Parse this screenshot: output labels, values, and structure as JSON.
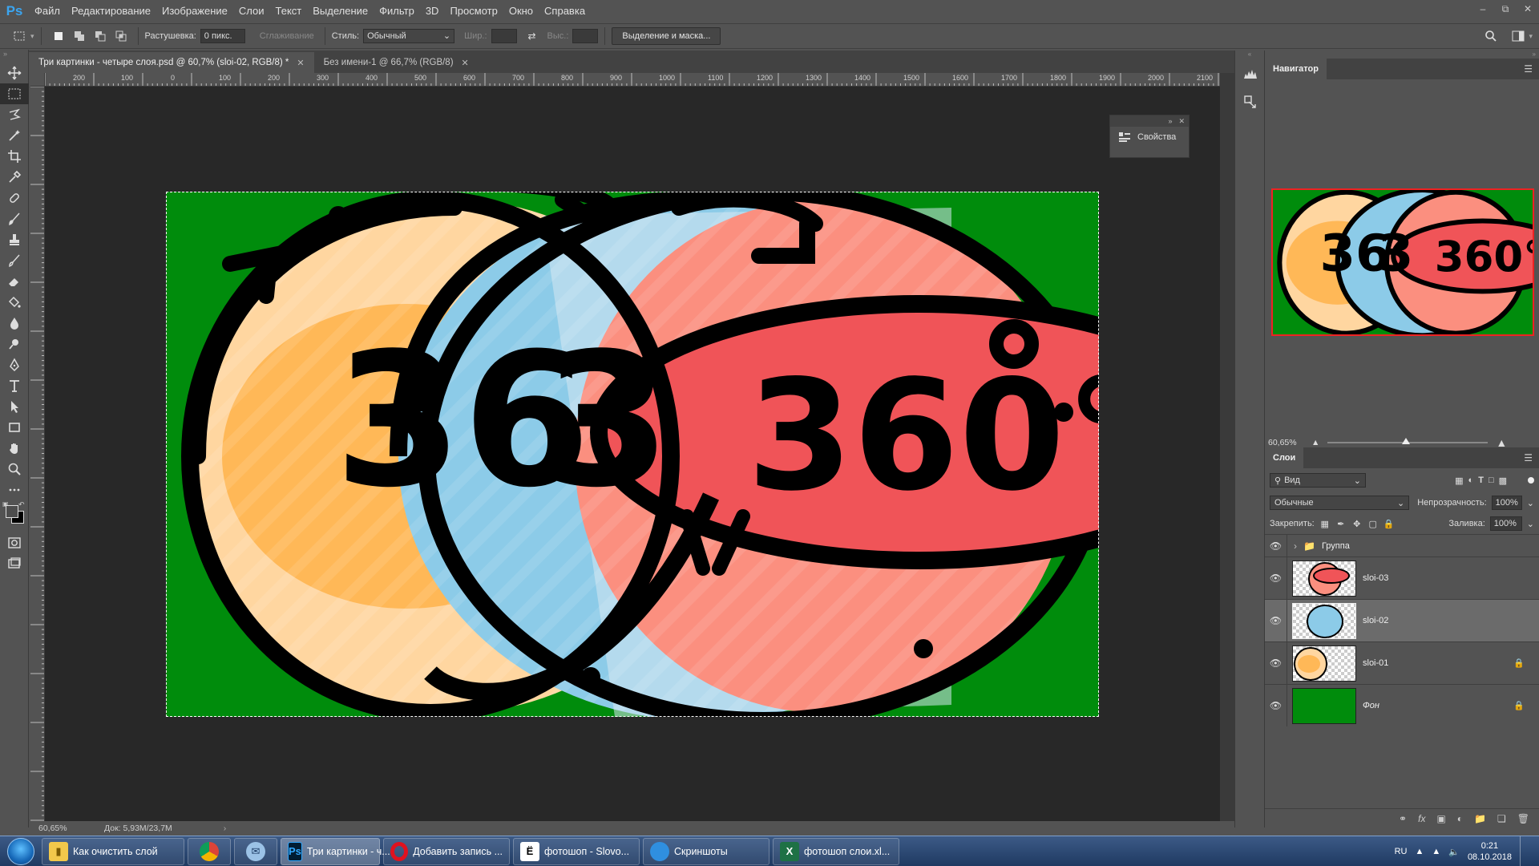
{
  "app": {
    "logo": "Ps",
    "menu": [
      "Файл",
      "Редактирование",
      "Изображение",
      "Слои",
      "Текст",
      "Выделение",
      "Фильтр",
      "3D",
      "Просмотр",
      "Окно",
      "Справка"
    ]
  },
  "options": {
    "feather_label": "Растушевка:",
    "feather_value": "0 пикс.",
    "antialias_label": "Сглаживание",
    "style_label": "Стиль:",
    "style_value": "Обычный",
    "width_label": "Шир.:",
    "height_label": "Выс.:",
    "select_mask_button": "Выделение и маска..."
  },
  "tabs": [
    {
      "label": "Три картинки - четыре слоя.psd @ 60,7% (sloi-02, RGB/8) *",
      "active": true
    },
    {
      "label": "Без имени-1 @ 66,7% (RGB/8)",
      "active": false
    }
  ],
  "ruler": {
    "h_ticks": [
      "200",
      "100",
      "0",
      "100",
      "200",
      "300",
      "400",
      "500",
      "600",
      "700",
      "800",
      "900",
      "1000",
      "1100",
      "1200",
      "1300",
      "1400",
      "1500",
      "1600",
      "1700",
      "1800",
      "1900",
      "2000",
      "2100"
    ]
  },
  "properties_float": {
    "label": "Свойства"
  },
  "status": {
    "zoom": "60,65%",
    "doc": "Док: 5,93M/23,7M"
  },
  "navigator": {
    "title": "Навигатор",
    "zoom": "60,65%"
  },
  "layers": {
    "title": "Слои",
    "filter_value": "Вид",
    "blend_mode": "Обычные",
    "opacity_label": "Непрозрачность:",
    "opacity_value": "100%",
    "lock_label": "Закрепить:",
    "fill_label": "Заливка:",
    "fill_value": "100%",
    "items": [
      {
        "name": "Группа",
        "type": "group"
      },
      {
        "name": "sloi-03",
        "type": "image"
      },
      {
        "name": "sloi-02",
        "type": "image",
        "selected": true
      },
      {
        "name": "sloi-01",
        "type": "image",
        "locked": true
      },
      {
        "name": "Фон",
        "type": "background",
        "locked": true
      }
    ]
  },
  "artwork": {
    "bg_color": "#008c0c",
    "labels": {
      "left": "36",
      "middle": "3",
      "right": "360°"
    }
  },
  "taskbar": {
    "items": [
      {
        "label": "Как очистить слой",
        "icon": "folder-icon"
      },
      {
        "label": "",
        "icon": "chrome-icon"
      },
      {
        "label": "",
        "icon": "mail-client-icon"
      },
      {
        "label": "Три картинки - ч...",
        "icon": "photoshop-icon",
        "active": true
      },
      {
        "label": "Добавить запись ...",
        "icon": "opera-icon"
      },
      {
        "label": "фотошоп - Slovo...",
        "icon": "word-icon"
      },
      {
        "label": "Скриншоты",
        "icon": "app-icon"
      },
      {
        "label": "фотошоп слои.xl...",
        "icon": "excel-icon"
      }
    ],
    "lang": "RU",
    "time": "0:21",
    "date": "08.10.2018"
  }
}
